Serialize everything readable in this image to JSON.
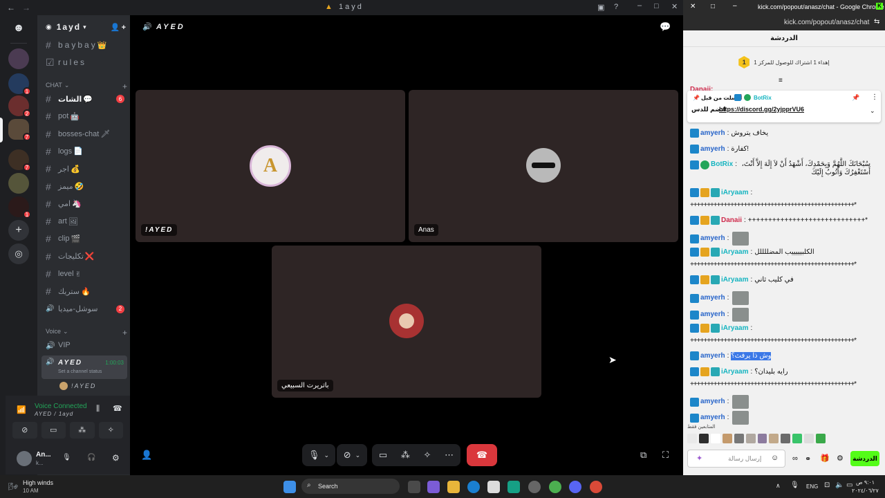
{
  "discord": {
    "window_title": "1ayd",
    "server_name": "1ayd",
    "server_badges": [
      "1",
      "2",
      "7",
      "7",
      "1"
    ],
    "channels": [
      {
        "name": "baybay",
        "icon": "👑",
        "type": "text"
      },
      {
        "name": "rules",
        "icon": "",
        "type": "rules"
      }
    ],
    "chat_category": "CHAT",
    "chat_channels": [
      {
        "name": "الشات",
        "icon": "💬",
        "badge": "6"
      },
      {
        "name": "pot",
        "icon": "🤖",
        "badge": ""
      },
      {
        "name": "bosses-chat",
        "icon": "🗡",
        "badge": ""
      },
      {
        "name": "logs",
        "icon": "📄",
        "badge": ""
      },
      {
        "name": "اجر",
        "icon": "💰",
        "badge": ""
      },
      {
        "name": "ميمز",
        "icon": "🤣",
        "badge": ""
      },
      {
        "name": "امي",
        "icon": "🦄",
        "badge": ""
      },
      {
        "name": "art",
        "icon": "🖼",
        "badge": ""
      },
      {
        "name": "clip",
        "icon": "🎬",
        "badge": ""
      },
      {
        "name": "تكليجات",
        "icon": "❌",
        "badge": ""
      },
      {
        "name": "level",
        "icon": "✌",
        "badge": ""
      },
      {
        "name": "ستريك",
        "icon": "🔥",
        "badge": ""
      },
      {
        "name": "سوشل-ميديا",
        "icon": "",
        "badge": "2"
      }
    ],
    "voice_category": "Voice",
    "voice_channels": [
      {
        "name": "VIP"
      },
      {
        "name": "AYED",
        "timer": "1:00:03",
        "status": "Set a channel status"
      }
    ],
    "voice_member": "!AYED",
    "voice_connected": "Voice Connected",
    "voice_path": "AYED / 1ayd",
    "user_name": "An...",
    "user_sub": "k..."
  },
  "call": {
    "header_title": "AYED",
    "participants": [
      {
        "label": "!AYED",
        "avatar_text": "A"
      },
      {
        "label": "Anas",
        "avatar_text": ""
      },
      {
        "label": "باتريرت السبيعي",
        "avatar_text": ""
      }
    ]
  },
  "browser": {
    "window_title": "kick.com/popout/anasz/chat - Google Chrome",
    "url": "kick.com/popout/anasz/chat",
    "chat_title": "الدردشة",
    "gift_banner": "إهداء 1 اشتراك للوصول للمركز 1",
    "gift_rank": "1",
    "pinned_user": "BotRix",
    "pinned_label": "أرسلت من قبل",
    "pinned_text": "انضم للدس",
    "pinned_link": "https://discord.gg/2yjpprVU6",
    "top_partial_user": "Danaii:"
  },
  "chat_messages": [
    {
      "user": "amyerh",
      "color": "blue",
      "badges": [
        "mod"
      ],
      "text": "يخاف يتروش",
      "emote": false
    },
    {
      "user": "amyerh",
      "color": "blue",
      "badges": [
        "mod"
      ],
      "text": "كفارة!",
      "emote": false
    },
    {
      "user": "BotRix",
      "color": "cyan",
      "badges": [
        "mod",
        "verified"
      ],
      "text": "سُبْحَانَكَ اللَّهُمَّ وَبِحَمْدِكَ، أَشْهَدُ أَنْ لاَ إِلَهَ إِلاَّ أَنْتَ، أَسْتَغْفِرُكَ وَأَتُوبُ إِلَيْكَ",
      "emote": false
    },
    {
      "user": "iAryaam",
      "color": "cyan",
      "badges": [
        "mod",
        "vip",
        "sub"
      ],
      "text": "",
      "emote": false
    },
    {
      "user": "",
      "color": "",
      "badges": [],
      "text": "+++++++++++++++++++++++++++++++++++++++++++++++++*",
      "emote": false
    },
    {
      "user": "Danaii",
      "color": "red",
      "badges": [
        "mod",
        "vip",
        "sub"
      ],
      "text": "+++++++++++++++++++++++++++++*",
      "emote": false
    },
    {
      "user": "amyerh",
      "color": "blue",
      "badges": [
        "mod"
      ],
      "text": "",
      "emote": true
    },
    {
      "user": "iAryaam",
      "color": "cyan",
      "badges": [
        "mod",
        "vip",
        "sub"
      ],
      "text": "الكلبيييييب المضللللل",
      "emote": false
    },
    {
      "user": "",
      "color": "",
      "badges": [],
      "text": "+++++++++++++++++++++++++++++++++++++++++++++++++*",
      "emote": false
    },
    {
      "user": "iAryaam",
      "color": "cyan",
      "badges": [
        "mod",
        "vip",
        "sub"
      ],
      "text": "في كليب ثاني",
      "emote": false
    },
    {
      "user": "amyerh",
      "color": "blue",
      "badges": [
        "mod"
      ],
      "text": "",
      "emote": true
    },
    {
      "user": "amyerh",
      "color": "blue",
      "badges": [
        "mod"
      ],
      "text": "",
      "emote": true
    },
    {
      "user": "iAryaam",
      "color": "cyan",
      "badges": [
        "mod",
        "vip",
        "sub"
      ],
      "text": "",
      "emote": false
    },
    {
      "user": "",
      "color": "",
      "badges": [],
      "text": "+++++++++++++++++++++++++++++++++++++++++++++++++*",
      "emote": false
    },
    {
      "user": "amyerh",
      "color": "blue",
      "badges": [
        "mod"
      ],
      "text": "وش ذا يرفث؟",
      "emote": false,
      "highlight": true
    },
    {
      "user": "iAryaam",
      "color": "cyan",
      "badges": [
        "mod",
        "vip",
        "sub"
      ],
      "text": "رايه بليدان؟",
      "emote": false
    },
    {
      "user": "",
      "color": "",
      "badges": [],
      "text": "+++++++++++++++++++++++++++++++++++++++++++++++++*",
      "emote": false
    },
    {
      "user": "amyerh",
      "color": "blue",
      "badges": [
        "mod"
      ],
      "text": "",
      "emote": true
    },
    {
      "user": "amyerh",
      "color": "blue",
      "badges": [
        "mod"
      ],
      "text": "",
      "emote": true
    }
  ],
  "chat_input": {
    "recent_label": "المتابعين فقط",
    "placeholder": "إرسال رسالة",
    "send_label": "الدردشة"
  },
  "taskbar": {
    "weather_title": "High winds",
    "weather_sub": "10 AM",
    "search": "Search",
    "lang": "ENG",
    "time": "٩:٠١ ص",
    "date": "٢٠٢٤/٠٦/٢٧"
  },
  "colors": {
    "kick_green": "#53fc18",
    "discord_bg": "#1e1f22",
    "tile_bg": "#2e2525",
    "hangup": "#da373c"
  }
}
